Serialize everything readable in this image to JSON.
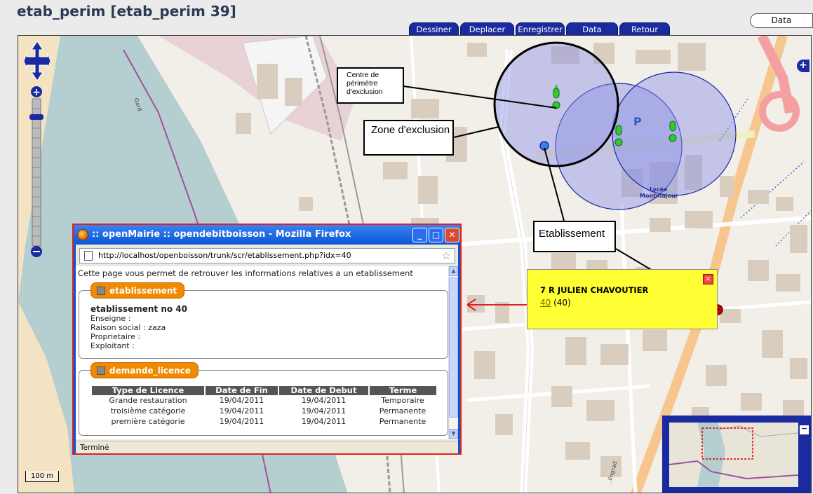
{
  "page": {
    "title": "etab_perim [etab_perim 39]"
  },
  "data_button": {
    "label": "Data"
  },
  "tabs": [
    {
      "label": "Dessiner"
    },
    {
      "label": "Deplacer"
    },
    {
      "label": "Enregistrer"
    },
    {
      "label": "Data"
    },
    {
      "label": "Retour"
    }
  ],
  "map": {
    "scale_label": "100 m",
    "street_labels": {
      "gard": "Gard",
      "lycee": "Lycée Montmajour",
      "parking": "P",
      "bottom_street": "..lingrad"
    },
    "annotations": {
      "centre": "Centre de périmètre d'exclusion",
      "zone": "Zone d'exclusion",
      "etablissement": "Etablissement"
    },
    "popup": {
      "address": "7 R JULIEN CHAVOUTIER",
      "link": "40",
      "id_text": "(40)"
    },
    "colors": {
      "circle_fill": "#8a90e6",
      "circle_stroke": "#1a2aa0",
      "popup_bg": "#ffff33"
    }
  },
  "firefox": {
    "title": ":: openMairie :: opendebitboisson - Mozilla Firefox",
    "url": "http://localhost/openboisson/trunk/scr/etablissement.php?idx=40",
    "intro": "Cette page vous permet de retrouver les informations relatives a un etablissement",
    "etablissement": {
      "legend": "etablissement",
      "heading": "etablissement no 40",
      "lines": [
        "Enseigne :",
        "Raison social : zaza",
        "Proprietaire :",
        "Exploitant :"
      ]
    },
    "licence": {
      "legend": "demande_licence",
      "headers": [
        "Type de Licence",
        "Date de Fin",
        "Date de Debut",
        "Terme"
      ],
      "rows": [
        [
          "Grande restauration",
          "19/04/2011",
          "19/04/2011",
          "Temporaire"
        ],
        [
          "troisième catégorie",
          "19/04/2011",
          "19/04/2011",
          "Permanente"
        ],
        [
          "première catégorie",
          "19/04/2011",
          "19/04/2011",
          "Permanente"
        ]
      ]
    },
    "status": "Terminé"
  }
}
